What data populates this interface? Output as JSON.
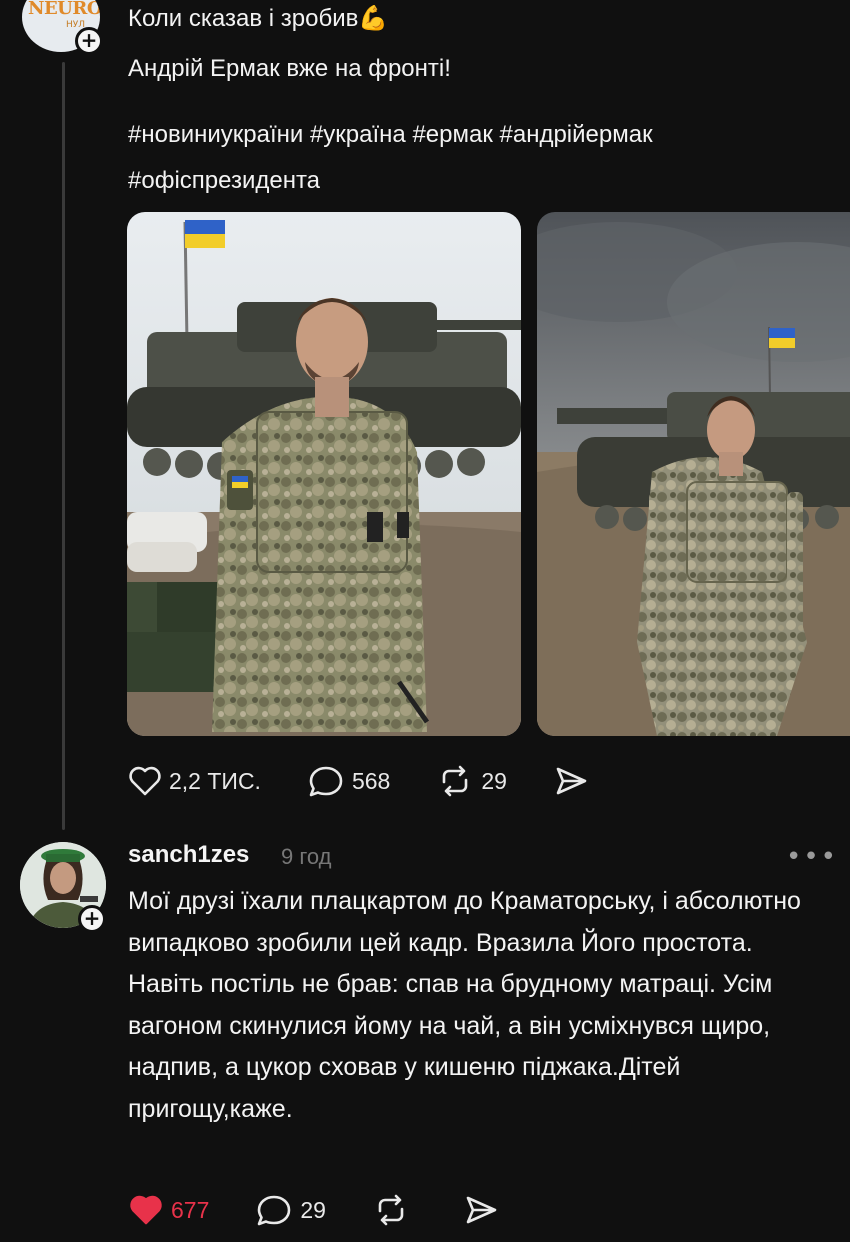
{
  "post": {
    "avatar_text": "NEURO",
    "avatar_subtext": "НУЛ",
    "line1": "Коли сказав і зробив💪",
    "line2": "Андрій Ермак вже на фронті!",
    "hashtags": "#новиниукраїни #україна #ермак #андрійермак #офіспрезидента",
    "likes": "2,2 ТИС.",
    "comments": "568",
    "reposts": "29"
  },
  "reply": {
    "username": "sanch1zes",
    "time": "9 год",
    "text": "Мої друзі їхали плацкартом до Краматорську, і абсолютно випадково зробили цей кадр. Вразила Його простота. Навіть постіль не брав: спав на брудному матраці. Усім вагоном скинулися йому на чай, а він усміхнувся щиро, надпив, а цукор сховав у кишеню піджака.Дітей пригощу,каже.",
    "likes": "677",
    "comments": "29"
  },
  "icons": {
    "like": "heart-icon",
    "comment": "speech-bubble-icon",
    "repost": "repost-icon",
    "share": "send-icon",
    "more": "more-icon",
    "follow": "plus-icon"
  },
  "colors": {
    "background": "#101010",
    "liked": "#e8324a",
    "muted": "#777777"
  }
}
